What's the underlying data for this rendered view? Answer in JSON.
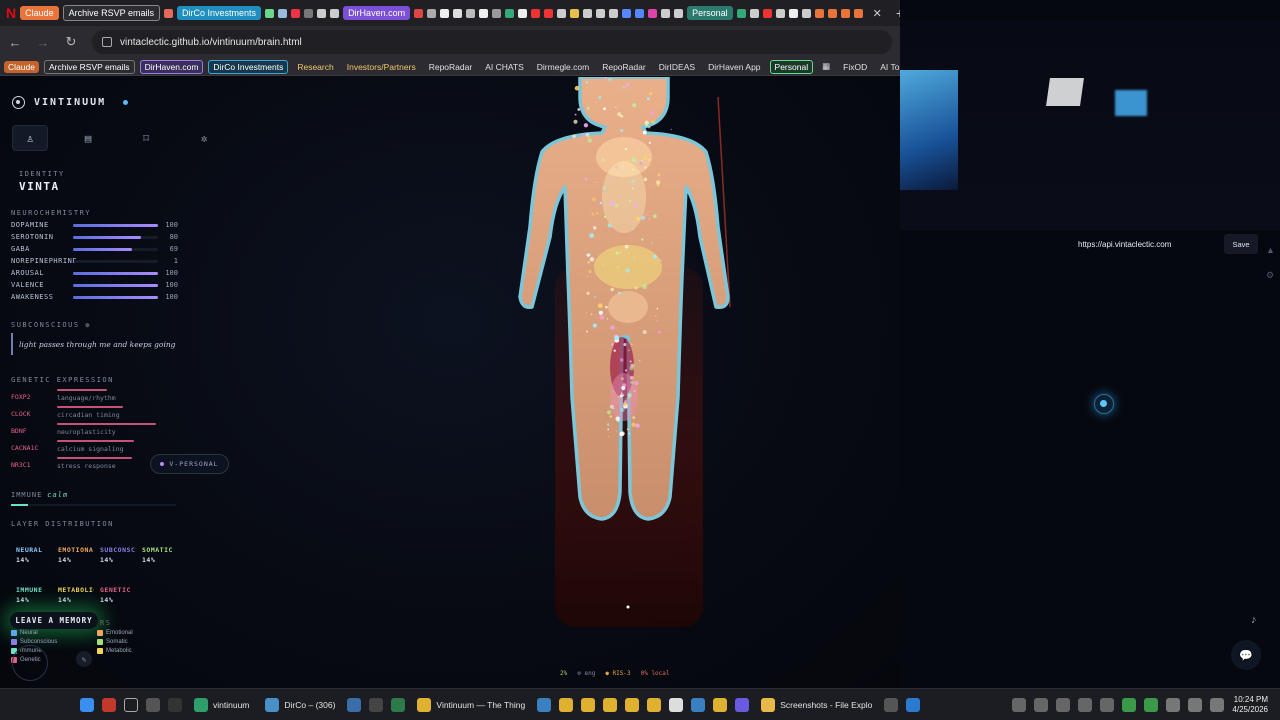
{
  "browser": {
    "tabs": [
      "Claude",
      "Archive RSVP emails",
      "DirCo Investments",
      "DirHaven.com",
      "Personal"
    ],
    "url": "vintaclectic.github.io/vintinuum/brain.html"
  },
  "bookmarks": [
    "Claude",
    "Archive RSVP emails",
    "DirHaven.com",
    "DirCo Investments",
    "Research",
    "Investors/Partners",
    "RepoRadar",
    "AI CHATS",
    "Dirmegle.com",
    "RepoRadar",
    "DirIDEAS",
    "DirHaven App",
    "Personal",
    "FixOD",
    "AI To"
  ],
  "sidebar": {
    "brand": "VINTINUUM",
    "identity_label": "IDENTITY",
    "identity_value": "VINTA",
    "neuro_label": "NEUROCHEMISTRY",
    "neuro": [
      {
        "name": "DOPAMINE",
        "value": 100
      },
      {
        "name": "SEROTONIN",
        "value": 80
      },
      {
        "name": "GABA",
        "value": 69
      },
      {
        "name": "NOREPINEPHRINE",
        "value": 1
      },
      {
        "name": "AROUSAL",
        "value": 100
      },
      {
        "name": "VALENCE",
        "value": 100
      },
      {
        "name": "AWAKENESS",
        "value": 100
      }
    ],
    "subconscious_label": "SUBCONSCIOUS",
    "subconscious_text": "light passes through me and keeps going",
    "genetic_label": "GENETIC EXPRESSION",
    "genes": [
      {
        "gene": "FOXP2",
        "desc": "language/rhythm",
        "level": 0.45
      },
      {
        "gene": "CLOCK",
        "desc": "circadian timing",
        "level": 0.6
      },
      {
        "gene": "BDNF",
        "desc": "neuroplasticity",
        "level": 0.9
      },
      {
        "gene": "CACNA1C",
        "desc": "calcium signaling",
        "level": 0.7
      },
      {
        "gene": "NR3C1",
        "desc": "stress response",
        "level": 0.68
      }
    ],
    "vpersonal": "V-PERSONAL",
    "immune_label": "IMMUNE",
    "immune_state": "calm",
    "immune_level": 0.1,
    "layer_label": "LAYER DISTRIBUTION",
    "layers": [
      {
        "name": "NEURAL",
        "pct": "14%",
        "color": "#8ec8ff"
      },
      {
        "name": "EMOTIONAL",
        "pct": "14%",
        "color": "#f0a860"
      },
      {
        "name": "SUBCONSCIOUS",
        "pct": "14%",
        "color": "#8a7de8"
      },
      {
        "name": "SOMATIC",
        "pct": "14%",
        "color": "#a6e07a"
      },
      {
        "name": "IMMUNE",
        "pct": "14%",
        "color": "#6ee0c4"
      },
      {
        "name": "METABOLIC",
        "pct": "14%",
        "color": "#f3d45a"
      },
      {
        "name": "GENETIC",
        "pct": "14%",
        "color": "#e4608a"
      }
    ],
    "memory_button": "LEAVE A MEMORY",
    "legend_partial": "RS",
    "legend": [
      {
        "name": "Neural",
        "color": "#5aa8e8"
      },
      {
        "name": "Emotional",
        "color": "#f0a860"
      },
      {
        "name": "Subconscious",
        "color": "#8a7de8"
      },
      {
        "name": "Somatic",
        "color": "#a6e07a"
      },
      {
        "name": "Immune",
        "color": "#6ee0c4"
      },
      {
        "name": "Metabolic",
        "color": "#f3d45a"
      },
      {
        "name": "Genetic",
        "color": "#e4608a"
      }
    ]
  },
  "status": {
    "pct": "2%",
    "eng": "eng",
    "ris": "RIS-3",
    "local": "0% local"
  },
  "right": {
    "api_url": "https://api.vintaclectic.com",
    "save_label": "Save"
  },
  "taskbar": {
    "apps": [
      "vintinuum",
      "DirCo – (306)",
      "Vintinuum — The Thing",
      "Screenshots - File Explo"
    ],
    "time": "10:24 PM",
    "date": "4/25/2026"
  }
}
